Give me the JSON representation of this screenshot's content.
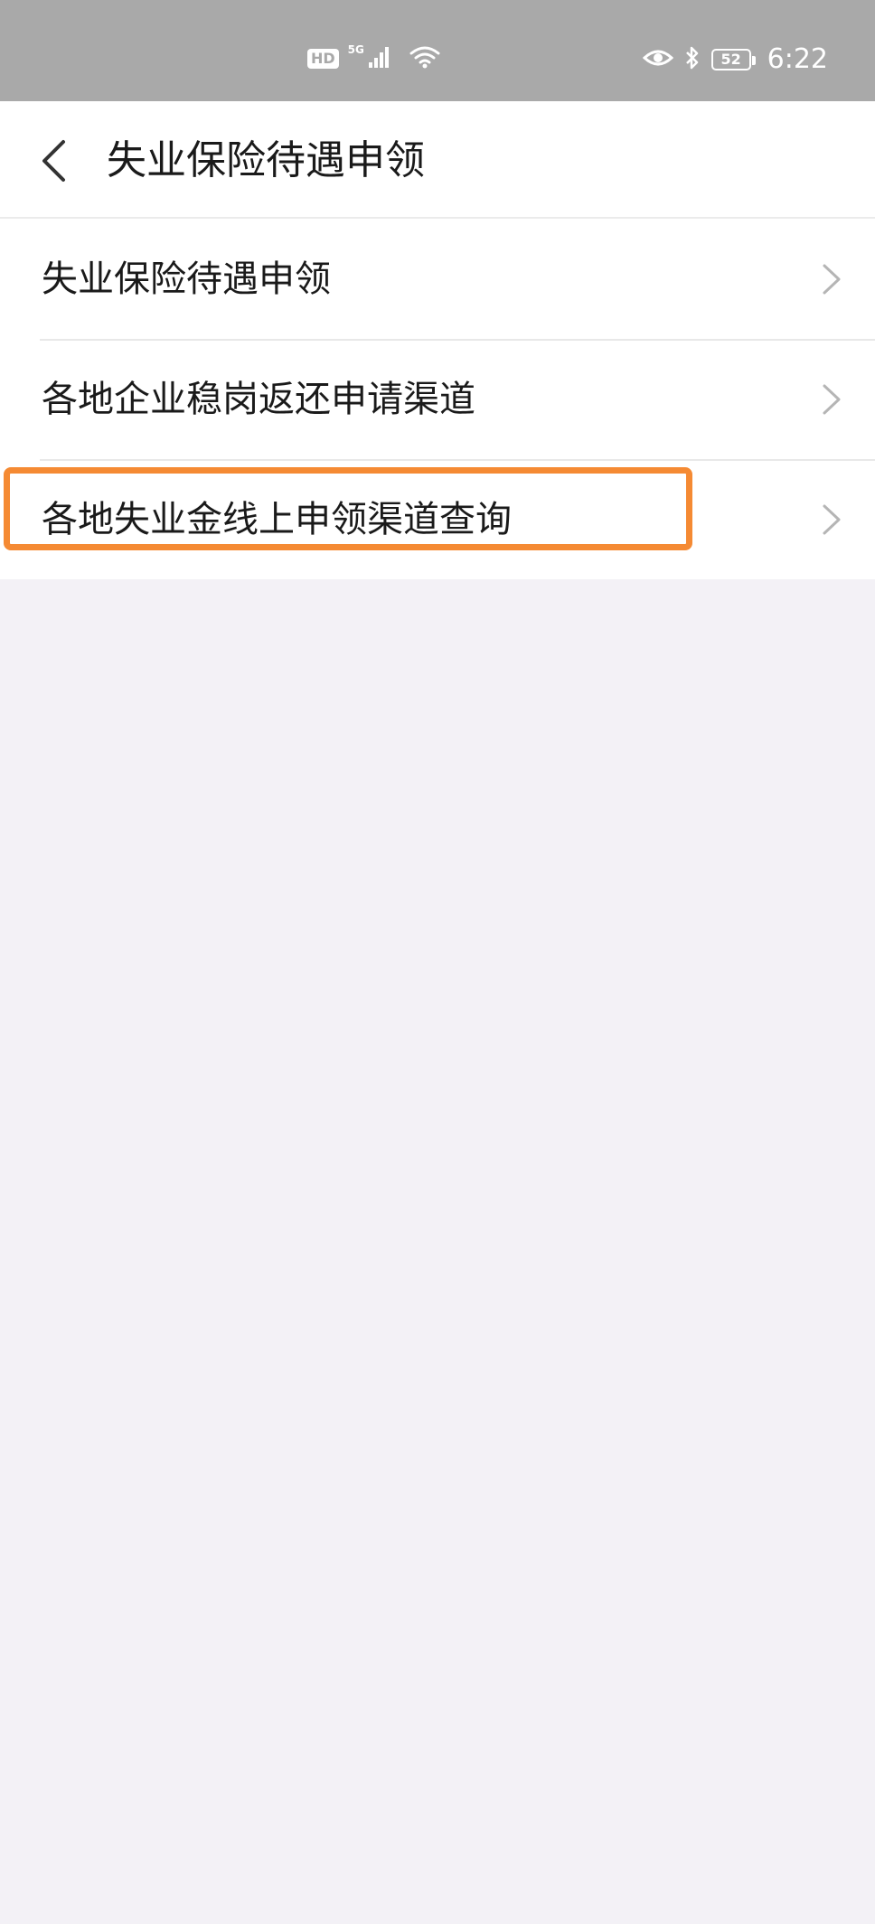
{
  "status_bar": {
    "hd_label": "HD",
    "network_label": "5G",
    "battery_level": "52",
    "time": "6:22",
    "icons": [
      "hd-icon",
      "signal-icon",
      "wifi-icon",
      "eye-icon",
      "bluetooth-icon",
      "battery-icon"
    ],
    "background_color": "#a9a9a9"
  },
  "header": {
    "back_icon": "chevron-left-icon",
    "title": "失业保险待遇申领"
  },
  "menu": {
    "items": [
      {
        "label": "失业保险待遇申领",
        "icon": "chevron-right-icon"
      },
      {
        "label": "各地企业稳岗返还申请渠道",
        "icon": "chevron-right-icon"
      },
      {
        "label": "各地失业金线上申领渠道查询",
        "icon": "chevron-right-icon",
        "highlighted": true
      }
    ],
    "highlight_color": "#f58a33"
  },
  "colors": {
    "page_background": "#f3f1f6",
    "surface": "#ffffff",
    "divider": "#e8e8e8",
    "chevron": "#b5b5b5",
    "text": "#1a1a1a"
  }
}
